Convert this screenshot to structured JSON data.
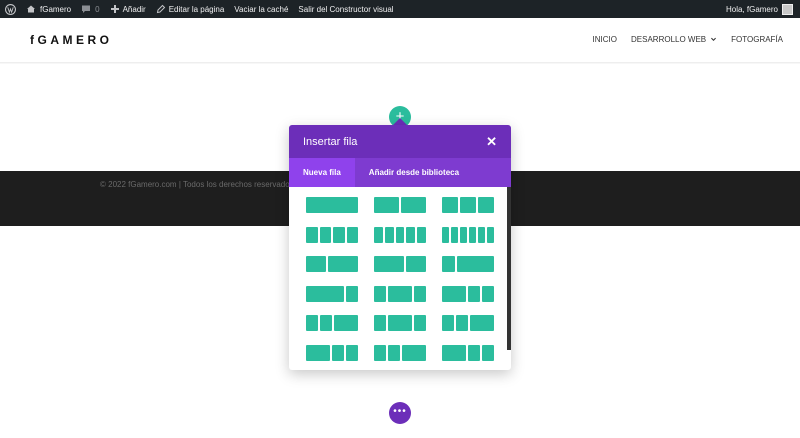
{
  "admin_bar": {
    "site_name": "fGamero",
    "comments_count": "0",
    "add_new": "Añadir",
    "edit_page": "Editar la página",
    "clear_cache": "Vaciar la caché",
    "exit_builder": "Salir del Constructor visual",
    "greeting": "Hola, fGamero"
  },
  "site": {
    "logo": "fGAMERO",
    "nav": [
      "INICIO",
      "DESARROLLO WEB",
      "FOTOGRAFÍA"
    ]
  },
  "footer": {
    "copyright": "© 2022 fGamero.com | Todos los derechos reservados"
  },
  "modal": {
    "title": "Insertar fila",
    "tabs": [
      "Nueva fila",
      "Añadir desde biblioteca"
    ],
    "active_tab": "Nueva fila",
    "layouts": [
      [
        [
          1
        ],
        [
          1,
          1
        ],
        [
          1,
          1,
          1
        ]
      ],
      [
        [
          1,
          1,
          1,
          1
        ],
        [
          1,
          1,
          1,
          1,
          1
        ],
        [
          1,
          1,
          1,
          1,
          1,
          1
        ]
      ],
      [
        [
          2,
          3
        ],
        [
          3,
          2
        ],
        [
          1,
          3
        ]
      ],
      [
        [
          3,
          1
        ],
        [
          1,
          2,
          1
        ],
        [
          2,
          1,
          1
        ]
      ],
      [
        [
          1,
          1,
          2
        ],
        [
          1,
          2,
          1
        ],
        [
          1,
          1,
          2
        ]
      ],
      [
        [
          2,
          1,
          1
        ],
        [
          1,
          1,
          2
        ],
        [
          2,
          1,
          1
        ]
      ]
    ]
  },
  "colors": {
    "accent_purple": "#6c2eb9",
    "tab_purple": "#7e3bd0",
    "teal": "#2bbd9d"
  },
  "icons": [
    "wordpress-icon",
    "home-icon",
    "comment-icon",
    "plus-icon",
    "pencil-icon",
    "chevron-down-icon",
    "close-icon"
  ]
}
